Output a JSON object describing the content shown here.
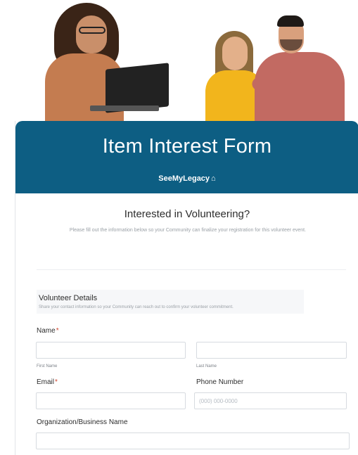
{
  "form": {
    "title": "Item Interest Form",
    "brand": "SeeMyLegacy",
    "intro_title": "Interested in Volunteering?",
    "intro_desc": "Please fill out the information below so your Community can finalize your registration for this volunteer event.",
    "section": {
      "title": "Volunteer Details",
      "subtitle": "Share your contact information so your Community can reach out to confirm your volunteer commitment."
    },
    "fields": {
      "name_label": "Name",
      "required_mark": "*",
      "first_name_sublabel": "First Name",
      "last_name_sublabel": "Last Name",
      "email_label": "Email",
      "phone_label": "Phone Number",
      "phone_placeholder": "(000) 000-0000",
      "org_label": "Organization/Business Name"
    }
  },
  "colors": {
    "banner": "#0d5e83",
    "required": "#d0452f"
  },
  "icons": {
    "brand": "house-icon"
  }
}
